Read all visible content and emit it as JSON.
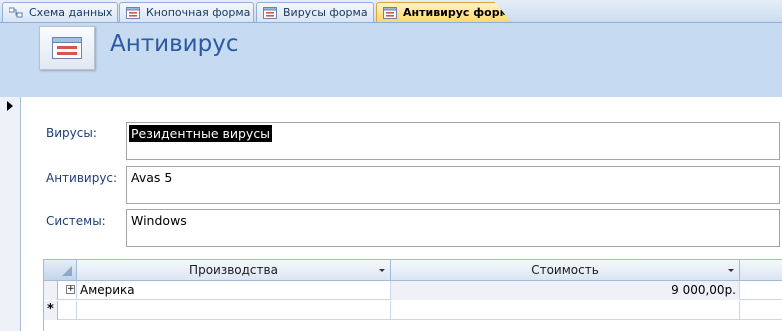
{
  "tabs": [
    {
      "label": "Схема данных",
      "icon": "relationships-icon"
    },
    {
      "label": "Кнопочная форма",
      "icon": "form-icon"
    },
    {
      "label": "Вирусы форма",
      "icon": "form-icon"
    },
    {
      "label": "Антивирус форм",
      "icon": "form-icon",
      "active": true
    }
  ],
  "header": {
    "title": "Антивирус",
    "icon": "form-icon"
  },
  "fields": [
    {
      "label": "Вирусы:",
      "value": "Резидентные вирусы",
      "selected": true
    },
    {
      "label": "Антивирус:",
      "value": "Avas 5"
    },
    {
      "label": "Системы:",
      "value": "Windows"
    }
  ],
  "subform": {
    "columns": [
      "Производства",
      "Стоимость"
    ],
    "rows": [
      {
        "production": "Америка",
        "cost": "9 000,00р."
      }
    ],
    "new_row_marker": "*"
  },
  "colors": {
    "header_bg": "#c6dbf2",
    "title": "#2b5aa0",
    "label": "#1f3f77",
    "active_tab": "#ffd770"
  }
}
